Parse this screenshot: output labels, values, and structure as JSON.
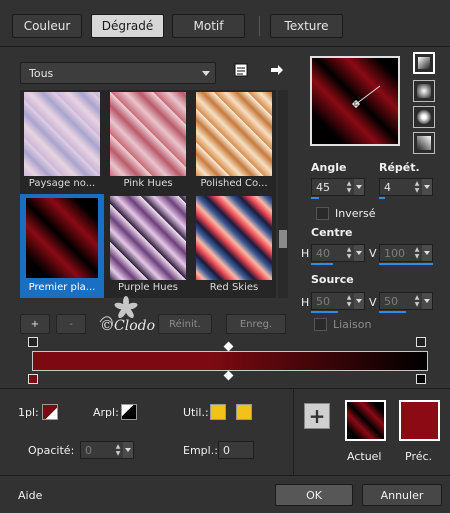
{
  "tabs": {
    "couleur": "Couleur",
    "degrade": "Dégradé",
    "motif": "Motif",
    "texture": "Texture"
  },
  "filter": {
    "selected": "Tous"
  },
  "gradients": [
    {
      "label": "Paysage no...",
      "selected": false
    },
    {
      "label": "Pink Hues",
      "selected": false
    },
    {
      "label": "Polished Co...",
      "selected": false
    },
    {
      "label": "Premier pla...",
      "selected": true
    },
    {
      "label": "Purple Hues",
      "selected": false
    },
    {
      "label": "Red Skies",
      "selected": false
    }
  ],
  "list_buttons": {
    "add": "+",
    "remove": "-",
    "reset": "Réinit.",
    "save": "Enreg."
  },
  "watermark": "©Clodo",
  "settings": {
    "angle_label": "Angle",
    "angle_value": "45",
    "repeat_label": "Répét.",
    "repeat_value": "4",
    "invert_label": "Inversé",
    "center_label": "Centre",
    "center_h_label": "H",
    "center_h_value": "40",
    "center_v_label": "V",
    "center_v_value": "100",
    "source_label": "Source",
    "source_h_label": "H",
    "source_h_value": "50",
    "source_v_label": "V",
    "source_v_value": "50",
    "link_label": "Liaison"
  },
  "editor": {
    "first_plan_label": "1pl:",
    "bg_label": "Arpl:",
    "user_label": "Util.:",
    "opacity_label": "Opacité:",
    "opacity_value": "0",
    "location_label": "Empl.:",
    "location_value": "0"
  },
  "current": {
    "add": "+",
    "current_label": "Actuel",
    "previous_label": "Préc."
  },
  "footer": {
    "help": "Aide",
    "ok": "OK",
    "cancel": "Annuler"
  },
  "colors": {
    "foreground": "#7d0a12",
    "background": "#000000",
    "user_color": "#f2c21b",
    "selection": "#1b6fc0",
    "accent_bar": "#2f8be6"
  }
}
